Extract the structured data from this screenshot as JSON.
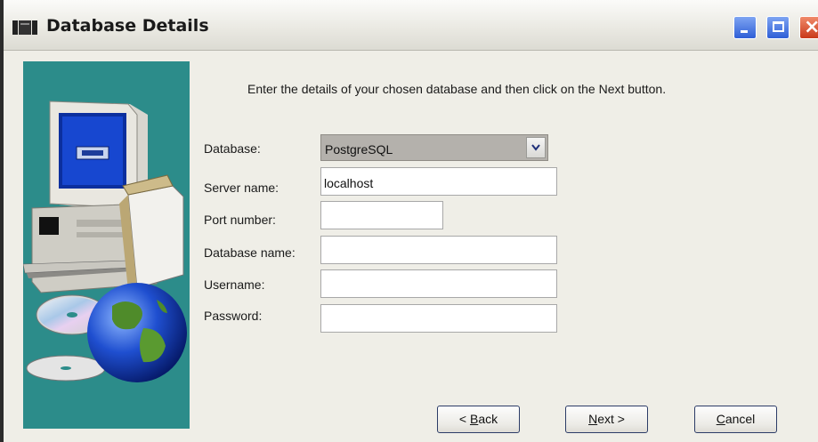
{
  "window": {
    "title": "Database Details"
  },
  "title_buttons": {
    "minimize": "minimize",
    "maximize": "maximize",
    "close": "×"
  },
  "instruction": "Enter the details of your chosen database and then click on the Next button.",
  "form": {
    "database_label": "Database:",
    "database_value": "PostgreSQL",
    "server_label": "Server name:",
    "server_value": "localhost",
    "port_label": "Port number:",
    "port_value": "",
    "dbname_label": "Database name:",
    "dbname_value": "",
    "username_label": "Username:",
    "username_value": "",
    "password_label": "Password:",
    "password_value": ""
  },
  "buttons": {
    "back_pre": "< ",
    "back_key": "B",
    "back_post": "ack",
    "next_key": "N",
    "next_post": "ext >",
    "cancel_key": "C",
    "cancel_post": "ancel"
  },
  "colors": {
    "side_panel": "#2c8c8a",
    "window_bg": "#efeee7"
  },
  "icons": [
    "window-app-icon",
    "minimize-icon",
    "maximize-icon",
    "close-icon",
    "chevron-down-icon",
    "computer-illustration",
    "cd-discs-illustration",
    "globe-illustration"
  ]
}
